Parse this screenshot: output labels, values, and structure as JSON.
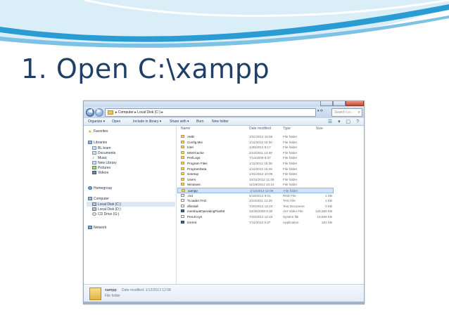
{
  "slide": {
    "title": "1. Open C:\\xampp"
  },
  "window": {
    "address": "▸ Computer ▸ Local Disk (C:) ▸",
    "search_placeholder": "Search Lo...",
    "toolbar": [
      "Organize ▾",
      "Open",
      "Include in library ▾",
      "Share with ▾",
      "Burn",
      "New folder"
    ],
    "nav": {
      "favorites": "Favorites",
      "libraries": "Libraries",
      "library_items": [
        "BL learn",
        "Documents",
        "Music",
        "New Library",
        "Pictures",
        "Videos"
      ],
      "homegroup": "Homegroup",
      "computer": "Computer",
      "drives": [
        "Local Disk (C:)",
        "Local Disk (D:)",
        "CD Drive (G:)"
      ],
      "network": "Network"
    },
    "columns": {
      "name": "Name",
      "date": "Date modified",
      "type": "Type",
      "size": "Size"
    },
    "files": [
      {
        "name": "AMD",
        "date": "1/31/2012 15:56",
        "type": "File folder",
        "size": "",
        "icon": "folder"
      },
      {
        "name": "Config.Msi",
        "date": "1/11/2012 15:30",
        "type": "File folder",
        "size": "",
        "icon": "folder"
      },
      {
        "name": "Intel",
        "date": "1/30/2012 9:17",
        "type": "File folder",
        "size": "",
        "icon": "folder"
      },
      {
        "name": "MSOCache",
        "date": "2/24/2011 13:30",
        "type": "File folder",
        "size": "",
        "icon": "folder"
      },
      {
        "name": "PerfLogs",
        "date": "7/14/2009 8:37",
        "type": "File folder",
        "size": "",
        "icon": "folder"
      },
      {
        "name": "Program Files",
        "date": "1/11/2012 15:36",
        "type": "File folder",
        "size": "",
        "icon": "folder"
      },
      {
        "name": "ProgramData",
        "date": "1/11/2012 15:28",
        "type": "File folder",
        "size": "",
        "icon": "folder"
      },
      {
        "name": "sosetup",
        "date": "1/31/2012 10:08",
        "type": "File folder",
        "size": "",
        "icon": "folder"
      },
      {
        "name": "Users",
        "date": "10/31/2012 11:49",
        "type": "File folder",
        "size": "",
        "icon": "folder"
      },
      {
        "name": "Windows",
        "date": "11/28/2012 10:24",
        "type": "File folder",
        "size": "",
        "icon": "folder"
      },
      {
        "name": "xampp",
        "date": "1/12/2013 12:08",
        "type": "File folder",
        "size": "",
        "icon": "folder"
      },
      {
        "name": ".rnd",
        "date": "5/18/2012 9:01",
        "type": "RND File",
        "size": "1 KB",
        "icon": "file"
      },
      {
        "name": "TLoader.TAG",
        "date": "2/24/2011 12:25",
        "type": "TAG File",
        "size": "1 KB",
        "icon": "file"
      },
      {
        "name": "dfinstall",
        "date": "7/20/2012 12:23",
        "type": "Text Document",
        "size": "0 KB",
        "icon": "file"
      },
      {
        "name": "membuatOperatingFlash8",
        "date": "10/28/2009 6:30",
        "type": "AVI Video File",
        "size": "126,560 KB",
        "icon": "app"
      },
      {
        "name": "PeruH.sys",
        "date": "7/20/2012 12:23",
        "type": "System file",
        "size": "15,856 KB",
        "icon": "file"
      },
      {
        "name": "torrent",
        "date": "7/11/2012 9:37",
        "type": "Application",
        "size": "181 KB",
        "icon": "app"
      }
    ],
    "selected_index": 10,
    "details": {
      "name": "xampp",
      "modified": "Date modified: 1/12/2013 12:08",
      "type": "File folder"
    }
  },
  "colors": {
    "title": "#1f3f66",
    "swoosh": "#2b9bd3",
    "selection": "#cfe3fa"
  }
}
